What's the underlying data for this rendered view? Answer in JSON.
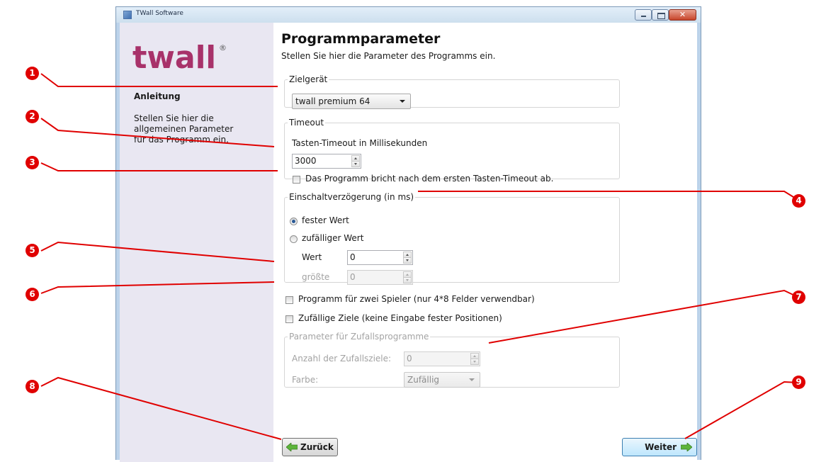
{
  "window": {
    "title": "TWall Software",
    "close_glyph": "✕"
  },
  "logo": {
    "text": "twall",
    "mark": "®"
  },
  "sidebar": {
    "heading": "Anleitung",
    "text": "Stellen Sie hier die allgemeinen Parameter für das Programm ein."
  },
  "page": {
    "title": "Programmparameter",
    "subtitle": "Stellen Sie hier die Parameter des Programms ein."
  },
  "zielgeraet": {
    "legend": "Zielgerät",
    "selected": "twall premium 64"
  },
  "timeout": {
    "legend": "Timeout",
    "label": "Tasten-Timeout in Millisekunden",
    "value": "3000",
    "abort_label": "Das Programm bricht nach dem ersten Tasten-Timeout ab.",
    "abort_checked": false
  },
  "einschalt": {
    "legend": "Einschaltverzögerung (in ms)",
    "fixed_label": "fester Wert",
    "random_label": "zufälliger Wert",
    "selected": "fixed",
    "wert_label": "Wert",
    "wert_value": "0",
    "groesste_label": "größte",
    "groesste_value": "0"
  },
  "options": {
    "two_players_label": "Programm für zwei Spieler (nur 4*8 Felder verwendbar)",
    "two_players_checked": false,
    "random_targets_label": "Zufällige Ziele (keine Eingabe fester Positionen)",
    "random_targets_checked": false
  },
  "zufall": {
    "legend": "Parameter für Zufallsprogramme",
    "count_label": "Anzahl der Zufallsziele:",
    "count_value": "0",
    "color_label": "Farbe:",
    "color_selected": "Zufällig"
  },
  "nav": {
    "back_label": "Zurück",
    "next_label": "Weiter"
  },
  "callouts": [
    "1",
    "2",
    "3",
    "4",
    "5",
    "6",
    "7",
    "8",
    "9"
  ],
  "colors": {
    "callout": "#e00000",
    "logo": "#a8326a",
    "sidebar": "#e9e7f2"
  }
}
